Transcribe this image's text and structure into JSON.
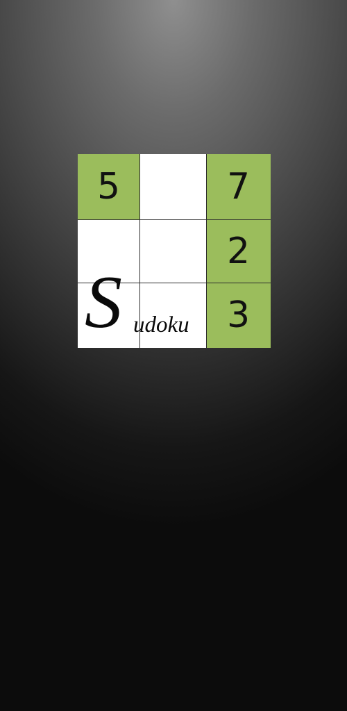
{
  "splash": {
    "grid": {
      "r0c0": "5",
      "r0c1": "",
      "r0c2": "7",
      "r1c0": "",
      "r1c1": "",
      "r1c2": "2",
      "r2c2": "3"
    },
    "logo_letter": "S",
    "logo_rest": "udoku"
  },
  "colors": {
    "accent_green": "#9bbd5c",
    "cell_white": "#ffffff",
    "background_top": "#8f8f8f",
    "background_bottom": "#0c0c0c"
  }
}
